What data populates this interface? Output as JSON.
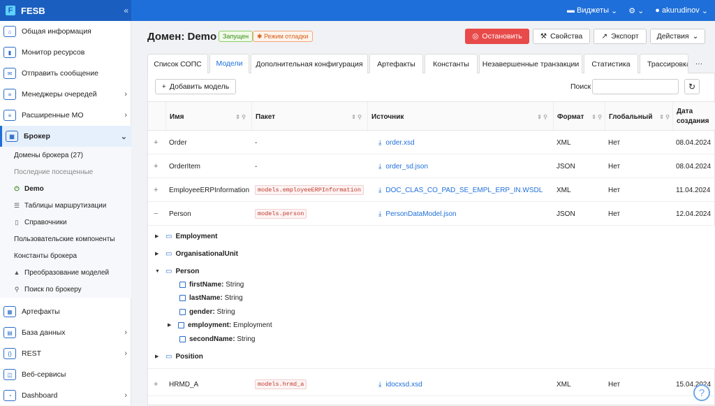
{
  "app": {
    "title": "FESB"
  },
  "topbar": {
    "widgets": "Виджеты",
    "user": "akurudinov"
  },
  "sidebar": {
    "items": [
      {
        "label": "Общая информация",
        "icon": "home-icon"
      },
      {
        "label": "Монитор ресурсов",
        "icon": "chart-icon"
      },
      {
        "label": "Отправить сообщение",
        "icon": "mail-icon"
      },
      {
        "label": "Менеджеры очередей",
        "icon": "queue-icon"
      },
      {
        "label": "Расширенные МО",
        "icon": "queue-ext-icon"
      },
      {
        "label": "Брокер",
        "icon": "broker-icon"
      },
      {
        "label": "Артефакты",
        "icon": "grid-icon"
      },
      {
        "label": "База данных",
        "icon": "database-icon"
      },
      {
        "label": "REST",
        "icon": "rest-icon"
      },
      {
        "label": "Веб-сервисы",
        "icon": "web-icon"
      },
      {
        "label": "Dashboard",
        "icon": "dashboard-icon"
      }
    ],
    "broker_sub": {
      "domains": "Домены брокера (27)",
      "recent": "Последние посещенные",
      "demo": "Demo",
      "routing": "Таблицы маршрутизации",
      "refs": "Справочники",
      "custom": "Пользовательские компоненты",
      "consts": "Константы брокера",
      "transform": "Преобразование моделей",
      "search": "Поиск по брокеру"
    }
  },
  "header": {
    "title": "Домен: Demo",
    "status": "Запущен",
    "debug": "Режим отладки",
    "stop": "Остановить",
    "props": "Свойства",
    "export": "Экспорт",
    "actions": "Действия"
  },
  "tabs": [
    "Список СОПС",
    "Модели",
    "Дополнительная конфигурация",
    "Артефакты",
    "Константы",
    "Незавершенные транзакции",
    "Статистика",
    "Трассировка"
  ],
  "toolbar": {
    "add": "Добавить модель",
    "search_label": "Поиск",
    "search_value": ""
  },
  "table": {
    "columns": [
      "Имя",
      "Пакет",
      "Источник",
      "Формат",
      "Глобальный",
      "Дата создания"
    ],
    "rows": [
      {
        "name": "Order",
        "pkg": "-",
        "source": "order.xsd",
        "format": "XML",
        "global": "Нет",
        "date": "08.04.2024"
      },
      {
        "name": "OrderItem",
        "pkg": "-",
        "source": "order_sd.json",
        "format": "JSON",
        "global": "Нет",
        "date": "08.04.2024"
      },
      {
        "name": "EmployeeERPInformation",
        "pkg": "models.employeeERPInformation",
        "source": "DOC_CLAS_CO_PAD_SE_EMPL_ERP_IN.WSDL",
        "format": "XML",
        "global": "Нет",
        "date": "11.04.2024"
      },
      {
        "name": "Person",
        "pkg": "models.person",
        "source": "PersonDataModel.json",
        "format": "JSON",
        "global": "Нет",
        "date": "12.04.2024"
      },
      {
        "name": "HRMD_A",
        "pkg": "models.hrmd_a",
        "source": "idocxsd.xsd",
        "format": "XML",
        "global": "Нет",
        "date": "15.04.2024"
      }
    ]
  },
  "tree": {
    "employment": "Employment",
    "orgunit": "OrganisationalUnit",
    "person": "Person",
    "f1": {
      "name": "firstName:",
      "type": "String"
    },
    "f2": {
      "name": "lastName:",
      "type": "String"
    },
    "f3": {
      "name": "gender:",
      "type": "String"
    },
    "f4": {
      "name": "employment:",
      "type": "Employment"
    },
    "f5": {
      "name": "secondName:",
      "type": "String"
    },
    "position": "Position"
  },
  "help": "?"
}
